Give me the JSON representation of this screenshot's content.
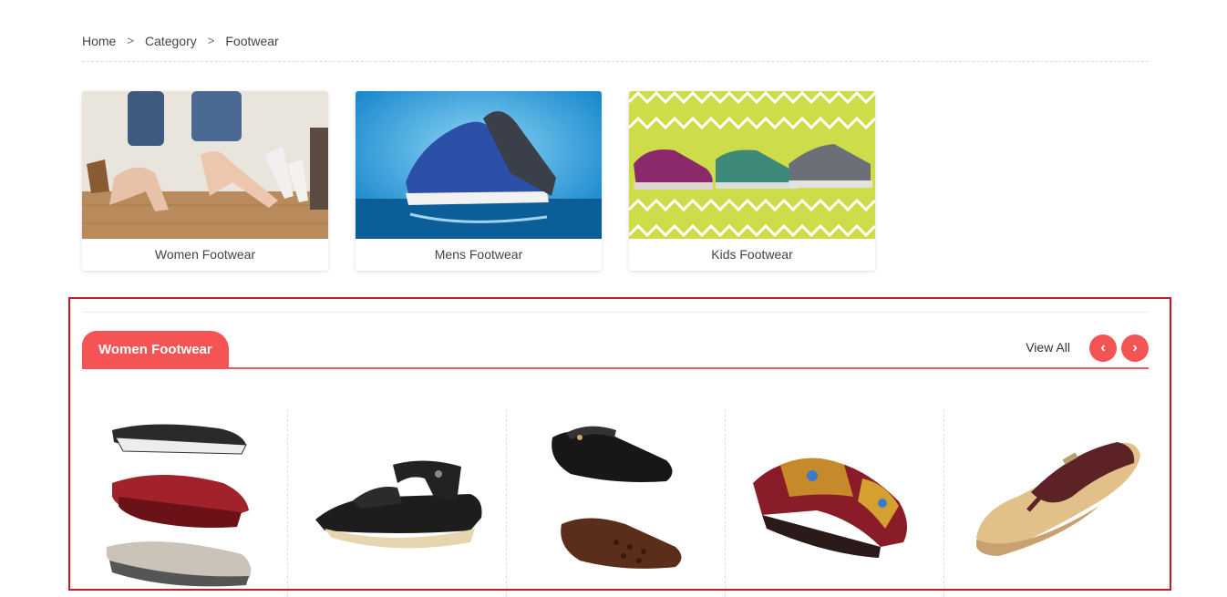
{
  "breadcrumb": {
    "items": [
      "Home",
      "Category",
      "Footwear"
    ],
    "separator": ">"
  },
  "categories": [
    {
      "label": "Women Footwear",
      "image": "women-heels-photo"
    },
    {
      "label": "Mens Footwear",
      "image": "mens-sneakers-photo"
    },
    {
      "label": "Kids Footwear",
      "image": "kids-shoes-photo"
    }
  ],
  "section": {
    "title": "Women Footwear",
    "view_all_label": "View All",
    "prev_icon": "chevron-left-icon",
    "next_icon": "chevron-right-icon",
    "prev_glyph": "‹",
    "next_glyph": "›"
  },
  "products": [
    {
      "image": "wedge-flip-flops-set"
    },
    {
      "image": "black-strap-sandal"
    },
    {
      "image": "ballet-flats-pair"
    },
    {
      "image": "embroidered-wedge-sandal"
    },
    {
      "image": "brown-thong-sandal"
    }
  ],
  "colors": {
    "accent": "#f45454",
    "highlight_border": "#d0191c"
  }
}
